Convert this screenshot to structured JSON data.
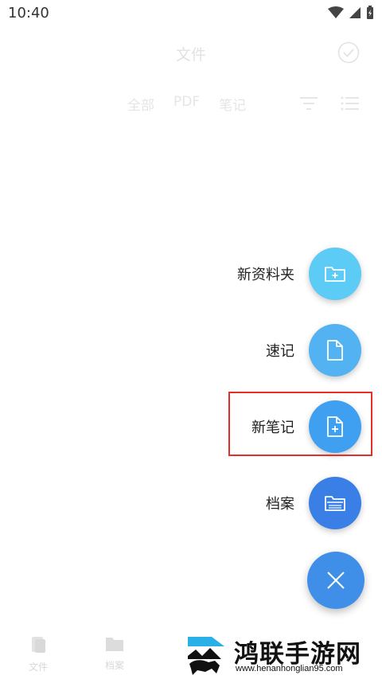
{
  "status_bar": {
    "time": "10:40"
  },
  "header": {
    "title": "文件"
  },
  "tabs": [
    {
      "label": "全部"
    },
    {
      "label": "PDF"
    },
    {
      "label": "笔记"
    }
  ],
  "fab_menu": [
    {
      "label": "新资料夹",
      "icon": "folder-plus-icon",
      "color": "#5ccbf5"
    },
    {
      "label": "速记",
      "icon": "document-icon",
      "color": "#52b2f2"
    },
    {
      "label": "新笔记",
      "icon": "document-plus-icon",
      "color": "#3f9ff0"
    },
    {
      "label": "档案",
      "icon": "folder-icon",
      "color": "#3a7fe6"
    }
  ],
  "close_fab": {
    "icon": "close-icon",
    "color": "#3f8fe8"
  },
  "highlight_color": "#e0302a",
  "bottom_nav": [
    {
      "label": "文件",
      "icon": "file-icon"
    },
    {
      "label": "档案",
      "icon": "folder-icon"
    }
  ],
  "watermark": {
    "title": "鸿联手游网",
    "url": "www.henanhonglian95.com"
  }
}
